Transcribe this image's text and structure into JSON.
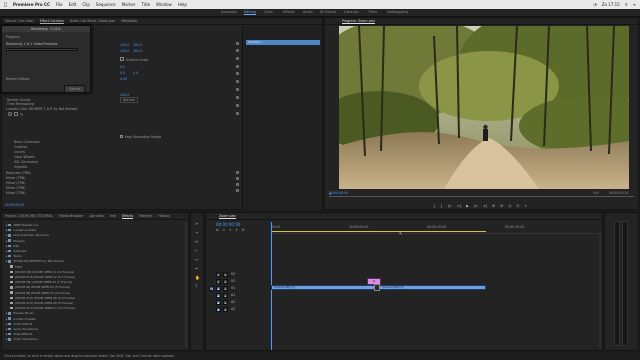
{
  "macbar": {
    "app": "Premiere Pro CC",
    "menus": [
      "File",
      "Edit",
      "Clip",
      "Sequence",
      "Marker",
      "Title",
      "Window",
      "Help"
    ],
    "right": [
      "Zo 17:15"
    ]
  },
  "workspaces": {
    "items": [
      "Assembly",
      "Editing",
      "Color",
      "Effects",
      "Audio",
      "All Panels",
      "Libraries",
      "Titles",
      "Metalogging"
    ],
    "active_index": 1
  },
  "effect_controls": {
    "tabs": [
      "Source: (no clips)",
      "Effect Controls",
      "Audio Clip Mixer: Zoom pan",
      "Metadata"
    ],
    "active_index": 1,
    "source_label": "Master * (ZOOM (IN) ...",
    "rows": [
      {
        "label": "Render Quality",
        "indent": 1
      },
      {
        "label": "Time Remapping",
        "indent": 1
      },
      {
        "label": "Lumetri Color (ROBERT 1 LUT by Bat Ahmed)",
        "indent": 0
      },
      {
        "label": "Basic Correction",
        "indent": 2
      },
      {
        "label": "Creative",
        "indent": 2
      },
      {
        "label": "Curves",
        "indent": 2
      },
      {
        "label": "Color Wheels",
        "indent": 2
      },
      {
        "label": "HSL Secondary",
        "indent": 2
      },
      {
        "label": "Vignette",
        "indent": 2
      },
      {
        "label": "Replicate (TRN)",
        "indent": 0
      },
      {
        "label": "Mirror (TRN)",
        "indent": 0
      },
      {
        "label": "Mirror (TRN)",
        "indent": 0
      },
      {
        "label": "Mirror (TRN)",
        "indent": 0
      },
      {
        "label": "Mirror (TRN)",
        "indent": 0
      }
    ],
    "values": [
      "100.0",
      "100.0",
      "100.0",
      "100.0",
      "0.0",
      "0.0",
      "0.0",
      "0.00"
    ],
    "checkbox_label": "Uniform Scale",
    "high_quality": "High Resolution Range",
    "normal": "Normal",
    "timecode": "00:00:00:00",
    "clip_name": "Transition"
  },
  "render_dialog": {
    "title": "Rendering - 0.21%",
    "progress_label": "Progress",
    "detail": "Rendering 1 of 1 Video Previews",
    "progress": 0.0021,
    "extra": "Render Details",
    "cancel": "Cancel"
  },
  "program": {
    "title": "Program: Zoom pan",
    "timecode_left": "00:00:00:00",
    "fit": "Full",
    "timecode_right": "00:00:03:14",
    "transport": [
      "{",
      "}",
      "|<",
      "<|",
      "▶",
      "|>",
      ">|",
      "⊞",
      "⊟",
      "◎",
      "⎘",
      "+"
    ]
  },
  "project": {
    "tabs": [
      "Project: ZOOM (IN) TUTORIAL",
      "Media Browser",
      "Libraries",
      "Info",
      "Effects",
      "Markers",
      "History"
    ],
    "active_index": 4,
    "items": [
      {
        "label": "ARES Presets 2.0",
        "icon": "folder",
        "level": 0
      },
      {
        "label": "Lumetri presets",
        "icon": "folder",
        "level": 0
      },
      {
        "label": "Lens Distortion Removal",
        "icon": "folder",
        "level": 0
      },
      {
        "label": "Mosaics",
        "icon": "folder",
        "level": 0
      },
      {
        "label": "PiPs",
        "icon": "folder",
        "level": 0
      },
      {
        "label": "Solarizes",
        "icon": "folder",
        "level": 0
      },
      {
        "label": "Twirls",
        "icon": "folder",
        "level": 0
      },
      {
        "label": "ZOOM (IN) PRESETS by Bat Ahmed",
        "icon": "folder",
        "level": 0
      },
      {
        "label": "TEST",
        "icon": "clip",
        "level": 1
      },
      {
        "label": "[ZOOM (IN)] ZOOM OPEN 01 (10 Frames)",
        "icon": "clip",
        "level": 1
      },
      {
        "label": "[ZOOM OUT] ZOOM OPEN 02 (13 Frames)",
        "icon": "clip",
        "level": 1
      },
      {
        "label": "[ZOOM (IN)] ZOOM OPEN 04 (7 Frames)",
        "icon": "clip",
        "level": 1
      },
      {
        "label": "[ZOOM IN] ZOOM OPEN 03 (5 Frames)",
        "icon": "clip",
        "level": 1
      },
      {
        "label": "[ZOOM IN] ZOOM OPEN 05 (9 Frames)",
        "icon": "clip",
        "level": 1
      },
      {
        "label": "[ZOOM OUT] ZOOM OPEN 06 (13 Frames)",
        "icon": "clip",
        "level": 1
      },
      {
        "label": "[ZOOM OUT] ZOOM OPEN 08 (5 Frames)",
        "icon": "clip",
        "level": 1
      },
      {
        "label": "[ZOOM OUT] ZOOM OPEN 07 (14 Frames)",
        "icon": "clip",
        "level": 1
      },
      {
        "label": "Presets Bin 01",
        "icon": "folder",
        "level": 0
      },
      {
        "label": "Lumetri Presets",
        "icon": "folder",
        "level": 0
      },
      {
        "label": "Audio Effects",
        "icon": "folder",
        "level": 0
      },
      {
        "label": "Audio Transitions",
        "icon": "folder",
        "level": 0
      },
      {
        "label": "Video Effects",
        "icon": "folder",
        "level": 0
      },
      {
        "label": "Video Transitions",
        "icon": "folder",
        "level": 0
      }
    ]
  },
  "timeline": {
    "tab": "Zoom pan",
    "timecode": "00:00:00:00",
    "ruler": [
      "00:00",
      "00:00:05:00",
      "00:00:10:00",
      "00:00:15:00"
    ],
    "tracks_video": [
      "V3",
      "V2",
      "V1"
    ],
    "tracks_audio": [
      "A1",
      "A2",
      "A3"
    ],
    "clip_v1a": "Tumultu.MP4 [V]",
    "clip_v1b": "Tumultu.MP4 [V]",
    "adjust": "fx"
  },
  "status": "Click to select, or click in empty space and drag to marquee select. Use Shift, Opt, and Cmd for other options."
}
